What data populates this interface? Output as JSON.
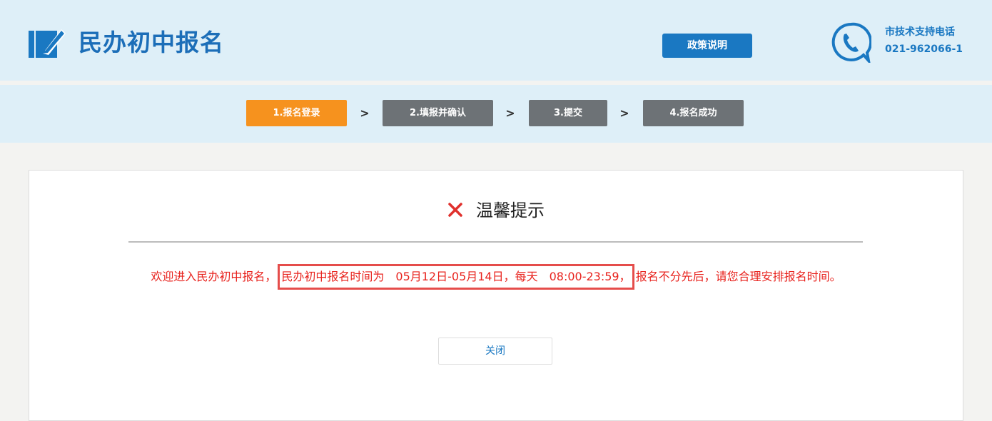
{
  "header": {
    "title": "民办初中报名",
    "policy_button": "政策说明",
    "support_label": "市技术支持电话",
    "support_phone": "021-962066-1"
  },
  "steps": [
    {
      "label": "1.报名登录",
      "active": true
    },
    {
      "label": "2.填报并确认",
      "active": false
    },
    {
      "label": "3.提交",
      "active": false
    },
    {
      "label": "4.报名成功",
      "active": false
    }
  ],
  "step_separator": ">",
  "dialog": {
    "title": "温馨提示",
    "message_before": "欢迎进入民办初中报名，",
    "message_highlight": "民办初中报名时间为　05月12日-05月14日，每天　08:00-23:59，",
    "message_after": "报名不分先后，请您合理安排报名时间。",
    "close_button": "关闭"
  },
  "colors": {
    "header_bg": "#deeff8",
    "brand_blue": "#1a78c2",
    "step_active": "#f6921e",
    "step_inactive": "#6d7276",
    "message_red": "#e8231e"
  }
}
